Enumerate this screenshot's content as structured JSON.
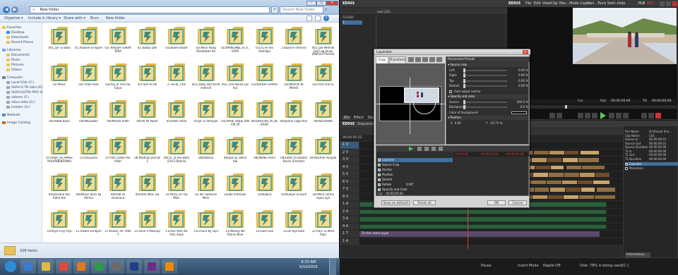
{
  "explorer": {
    "address_root": "«",
    "address_path": "New folder",
    "search_placeholder": "Search New folder",
    "toolbar": {
      "organize": "Organize ▾",
      "include": "Include in library ▾",
      "share": "Share with ▾",
      "burn": "Burn",
      "new_folder": "New folder"
    },
    "nav": [
      {
        "label": "Favorites",
        "kind": "star",
        "indent": 0
      },
      {
        "label": "Desktop",
        "kind": "desktop",
        "indent": 1
      },
      {
        "label": "Downloads",
        "kind": "folder",
        "indent": 1
      },
      {
        "label": "Recent Places",
        "kind": "folder",
        "indent": 1
      },
      {
        "label": "",
        "kind": "spacer",
        "indent": 0
      },
      {
        "label": "Libraries",
        "kind": "library",
        "indent": 0
      },
      {
        "label": "Documents",
        "kind": "folder",
        "indent": 1
      },
      {
        "label": "Music",
        "kind": "folder",
        "indent": 1
      },
      {
        "label": "Pictures",
        "kind": "folder",
        "indent": 1
      },
      {
        "label": "Videos",
        "kind": "folder",
        "indent": 1
      },
      {
        "label": "",
        "kind": "spacer",
        "indent": 0
      },
      {
        "label": "Computer",
        "kind": "computer",
        "indent": 0
      },
      {
        "label": "Local Disk (C:)",
        "kind": "disk",
        "indent": 1
      },
      {
        "label": "SHAH 6 TB data (D:)",
        "kind": "disk",
        "indent": 1
      },
      {
        "label": "SHAH ULTRA PRO (E:)",
        "kind": "disk",
        "indent": 1
      },
      {
        "label": "saleem (F:)",
        "kind": "disk",
        "indent": 1
      },
      {
        "label": "edius data (G:)",
        "kind": "disk",
        "indent": 1
      },
      {
        "label": "Instaler (H:)",
        "kind": "disk",
        "indent": 1
      },
      {
        "label": "",
        "kind": "spacer",
        "indent": 0
      },
      {
        "label": "Network",
        "kind": "network",
        "indent": 0
      },
      {
        "label": "",
        "kind": "spacer",
        "indent": 0
      },
      {
        "label": "Image Catalog",
        "kind": "catalog",
        "indent": 0
      }
    ],
    "files": [
      "001_Dil Tu Bata",
      "01.Aaalam Echqum",
      "01c KHUDA SUKRA TERA",
      "01.sBaby Doll",
      "01cBoom Boom",
      "01cMain Rang Sharbaton Ka",
      "01cMANGANE_H_O_GAYE",
      "01cTu Hi Hai Aashiqui",
      "1.Baarish (Remix)",
      "002_Jad Mehndi Lag Lag Javey (Mehndi Promo)",
      "02.Music",
      "02c Allah kare",
      "02cAaj To Tera Ho Gaya",
      "02cTum Hi Ho",
      "2- Hindi_Title",
      "003_baby doll bride mehndi",
      "003_Tere Naina (jai ho)",
      "03cKHUDA GAVAH",
      "03cMehndi Ni Mehdi",
      "03cTrait mai tu",
      "04cHabb Bana",
      "04cMarjawan",
      "04cMasha Allah",
      "04cPe Pe Paam",
      "05cAllah Allah",
      "05cJe Tu Akhiyan",
      "05cVAHE VAJDE JAN VIR DI",
      "06cDHOLNA_HI_BLKAAR",
      "06cJeene Laga Hon",
      "06cNAZRANA",
      "07cAAJA_VE_MAHEYA(HABBIBAANA)",
      "07cSaiyaara",
      "07cYeh Ladka Hai Allah",
      "08.Madhup Jannat 2",
      "08cTu Tu Hai Wahi (2013 Remix)",
      "08cBabina",
      "08cJab Sy Dekhi Hai",
      "08cMENE HOGI",
      "08.Kabhi to Baadal Barse (Female)",
      "08.Nachde Punjabi",
      "09cDevana Kar Raha Hai",
      "09cMusic Bech Ky Rehna",
      "09cRab ta shukrana",
      "09cVela Mitni Da",
      "10.Party On my Mein",
      "10.Teri Saanson Mein",
      "10cBe Intehaan",
      "10cKabira",
      "10cKudiye Di Kurti",
      "10cMera sohna sajan aya",
      "10cPiya o Ry Piya",
      "11.Aalam Echqum",
      "11.Khaisir Ae Tittle 7",
      "11.Race 2 Mashup",
      "11cAisi Veer Nu Vian Aaye",
      "11cChura Ky Leja",
      "11cManey Ne Romic New",
      "11cSadi Gali",
      "12.Dil Kya Kare",
      "12.Rani Tu Mein Raja",
      "",
      "",
      "",
      "",
      "",
      "",
      "",
      "",
      "",
      ""
    ],
    "status_count": "106 items"
  },
  "taskbar": {
    "time": "6:33 AM",
    "date": "6/14/2016",
    "apps": [
      "start",
      "ie",
      "explorer",
      "chrome",
      "media",
      "video",
      "edius",
      "photoshop",
      "ae",
      "vlc"
    ]
  },
  "edius": {
    "app_name": "EDIUS",
    "preview_title": "EDIUS",
    "menu": [
      "File",
      "Edit",
      "View",
      "Clip",
      "Mar...",
      "Mode Capt...",
      "Ren...",
      "Tools Setti...",
      "Help"
    ],
    "plr_label": "PLR",
    "rec_label": "REC",
    "bin": {
      "header": "FOLDER",
      "root": "root (2/2)",
      "item": "2"
    },
    "bin_tabs": [
      "Bin",
      "Effect",
      "Sour"
    ],
    "timecode_left": "00:00:45:23",
    "timecode_cur": "00:45:23",
    "timecode_in": "Cur",
    "timecode_out": "Out",
    "timecode_ttl": "Ttl",
    "timecode_out_value": "00:00:00:00",
    "timecode_ttl_value": "00:00:00:00",
    "timeline_title": "Sequence1",
    "track_labels": [
      "1 V",
      "2 V",
      "3 V",
      "4 V",
      "5 V",
      "6 V",
      "7 V",
      "8 V",
      "1 A",
      "2 A",
      "3 A",
      "4 A",
      "1 T",
      "1 A"
    ],
    "layouter": {
      "title": "Layouter",
      "tabs": [
        "Crop",
        "Transform"
      ],
      "right_tabs": [
        "Parameter",
        "Preset"
      ],
      "params": [
        {
          "label": "Source crop",
          "value": "",
          "kind": "section"
        },
        {
          "label": "Left",
          "value": "0.00 %",
          "kind": "slider"
        },
        {
          "label": "Right",
          "value": "0.00 %",
          "kind": "slider"
        },
        {
          "label": "Top",
          "value": "0.00 %",
          "kind": "slider"
        },
        {
          "label": "Bottom",
          "value": "0.00 %",
          "kind": "slider"
        },
        {
          "label": "Auto adjust anchor",
          "value": "",
          "kind": "check"
        },
        {
          "label": "Opacity and color",
          "value": "",
          "kind": "section"
        },
        {
          "label": "Source",
          "value": "100.0 %",
          "kind": "slider"
        },
        {
          "label": "Background",
          "value": "0.0 %",
          "kind": "slider"
        },
        {
          "label": "Color of background",
          "value": "",
          "kind": "color"
        },
        {
          "label": "Position",
          "value": "",
          "kind": "section"
        },
        {
          "label": "X",
          "value": "0.00",
          "kind": "xy"
        },
        {
          "label": "Y",
          "value": "-25.71 %",
          "kind": "xy"
        }
      ],
      "kf_rows": [
        "Layouter",
        "Source Crop",
        "Anchor",
        "Position",
        "Stretch",
        "Rotate",
        "Opacity and Color"
      ],
      "rotate_value": "0.00°",
      "cur_label": "Cur",
      "cur_value": "00:00:00:00",
      "ruler_marks": [
        "00:00:00",
        "00:00:01:00",
        "00:00:02:00"
      ],
      "save_default": "Save as default",
      "reset_all": "Reset all",
      "ok": "OK",
      "cancel": "Cancel"
    },
    "info": {
      "headers": [
        "File Name",
        "Clip Name",
        "Source In",
        "Source Out",
        "Source Duration",
        "TL In",
        "TL Out",
        "TL Duration"
      ],
      "values": [
        "D:\\Shaadi Sha...",
        "C01",
        "00:00:06:01",
        "00:00:06:01",
        "00:00:00:00",
        "00:00:00:00",
        "00:00:00:00",
        "00:00:00:00"
      ],
      "effects": [
        "Layouter",
        "Monotone"
      ],
      "tab": "Information"
    },
    "status": {
      "pause": "Pause",
      "insert": "Insert Mode",
      "ripple": "Ripple Off",
      "disk": "Disk: 78% is being used(C:)"
    },
    "track_text": "Tu har mera pyar"
  }
}
